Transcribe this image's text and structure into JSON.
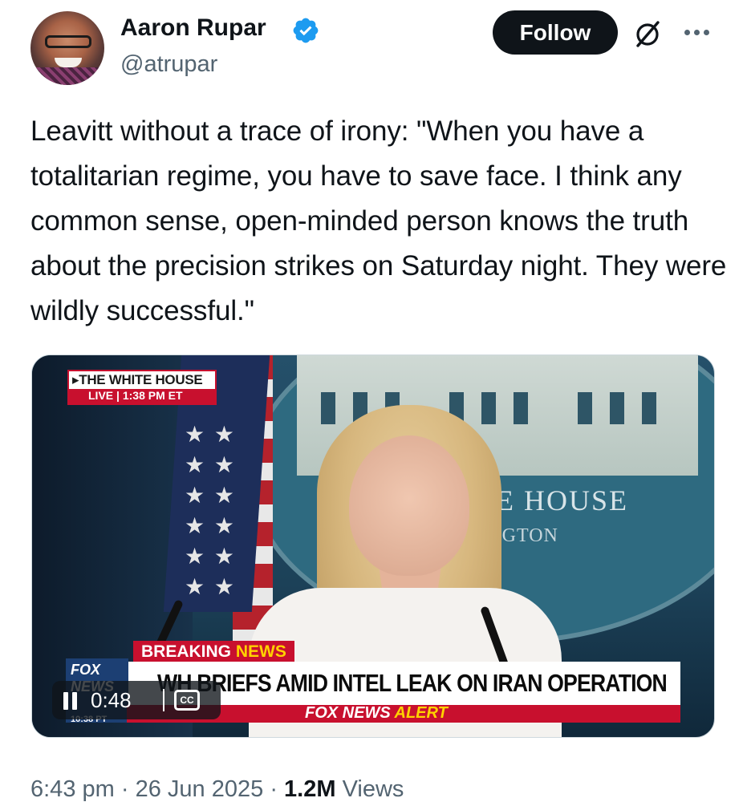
{
  "author": {
    "name": "Aaron Rupar",
    "handle": "@atrupar",
    "verified": true
  },
  "actions": {
    "follow_label": "Follow"
  },
  "icons": {
    "verified": "verified-badge-icon",
    "grok": "grok-icon",
    "more": "more-icon",
    "pause": "pause-icon",
    "captions": "closed-captions-icon"
  },
  "colors": {
    "verified_blue": "#1d9bf0",
    "text": "#0f1419",
    "secondary_text": "#536471",
    "fox_red": "#c8102e",
    "fox_yellow": "#ffd200"
  },
  "tweet": {
    "text": "Leavitt without a trace of irony: \"When you have a totalitarian regime, you have to save face. I think any common sense, open-minded person knows the truth about the precision strikes on Saturday night. They were wildly successful.\""
  },
  "video": {
    "bug_title": "THE WHITE HOUSE",
    "bug_live": "LIVE",
    "bug_time": "1:38 PM ET",
    "backdrop_text": "ITE HOUSE",
    "backdrop_subtext": "HINGTON",
    "breaking_label": "BREAKING",
    "breaking_news": "NEWS",
    "headline": "WH BRIEFS AMID INTEL LEAK ON IRAN OPERATION",
    "alert_prefix": "FOX NEWS",
    "alert_suffix": "ALERT",
    "fox_logo": "FOX NEWS",
    "fox_clock": "10:38 PT",
    "time_elapsed": "0:48",
    "cc_label": "CC"
  },
  "meta": {
    "time": "6:43 pm",
    "separator": "·",
    "date": "26 Jun 2025",
    "views_count": "1.2M",
    "views_label": "Views"
  }
}
